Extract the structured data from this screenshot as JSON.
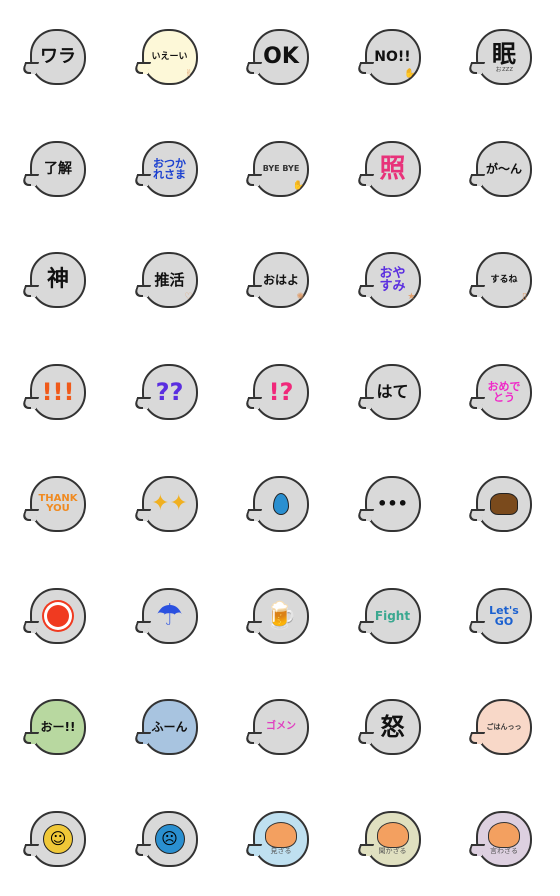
{
  "colors": {
    "bubble_gray": "#d9d9d9",
    "outline": "#333333"
  },
  "stickers": [
    {
      "name": "wara",
      "text": "ワラ",
      "color": "#111",
      "size": 18,
      "bg": "#d9d9d9"
    },
    {
      "name": "ieei",
      "text": "いえーい",
      "color": "#111",
      "size": 9,
      "bg": "#fdf8d8",
      "icon": "peace-hand"
    },
    {
      "name": "ok",
      "text": "OK",
      "color": "#111",
      "size": 22,
      "bg": "#d9d9d9",
      "icon": "sparkle"
    },
    {
      "name": "no",
      "text": "NO!!",
      "color": "#111",
      "size": 14,
      "bg": "#d9d9d9",
      "icon": "raised-hand"
    },
    {
      "name": "nemui",
      "text": "眠",
      "sub": "ぉzzz",
      "color": "#111",
      "size": 24,
      "bg": "#d9d9d9"
    },
    {
      "name": "ryoukai",
      "text": "了解",
      "color": "#111",
      "size": 14,
      "bg": "#d9d9d9",
      "icon": "ear"
    },
    {
      "name": "otsukaresama",
      "text": "おつか\nれさま",
      "color": "#1a3fd0",
      "size": 11,
      "bg": "#d9d9d9"
    },
    {
      "name": "byebye",
      "text": "BYE BYE",
      "color": "#333",
      "size": 8,
      "bg": "#d9d9d9",
      "icon": "waving-hand"
    },
    {
      "name": "tere",
      "text": "照",
      "color": "#e8327a",
      "size": 26,
      "bg": "#d9d9d9"
    },
    {
      "name": "gaan",
      "text": "が〜ん",
      "color": "#111",
      "size": 12,
      "bg": "#d9d9d9"
    },
    {
      "name": "kami",
      "text": "神",
      "color": "#111",
      "size": 22,
      "bg": "#d9d9d9",
      "icon": "halo"
    },
    {
      "name": "oshikatsu",
      "text": "推活",
      "color": "#111",
      "size": 15,
      "bg": "#d9d9d9",
      "icon": "hearts"
    },
    {
      "name": "ohayo",
      "text": "おはよ",
      "color": "#111",
      "size": 12,
      "bg": "#d9d9d9",
      "icon": "sun-doodle"
    },
    {
      "name": "oyasumi",
      "text": "おや\nすみ",
      "color": "#5a2ee0",
      "size": 13,
      "bg": "#d9d9d9",
      "icon": "stars"
    },
    {
      "name": "surune",
      "text": "するね",
      "color": "#111",
      "size": 9,
      "bg": "#d9d9d9",
      "icon": "phone"
    },
    {
      "name": "exclaim",
      "text": "!!!",
      "color": "#f05a1a",
      "size": 24,
      "bg": "#d9d9d9"
    },
    {
      "name": "question",
      "text": "??",
      "color": "#5a2ee0",
      "size": 24,
      "bg": "#d9d9d9"
    },
    {
      "name": "exclaim-question",
      "text": "!?",
      "color": "#f0287a",
      "size": 24,
      "bg": "#d9d9d9"
    },
    {
      "name": "hate",
      "text": "はて",
      "color": "#111",
      "size": 16,
      "bg": "#d9d9d9"
    },
    {
      "name": "omedetou",
      "text": "おめで\nとう",
      "color": "#f028c8",
      "size": 11,
      "bg": "#d9d9d9",
      "icon": "party-popper"
    },
    {
      "name": "thankyou",
      "text": "THANK\nYOU",
      "color": "#f08a20",
      "size": 10,
      "bg": "#d9d9d9"
    },
    {
      "name": "sparkles",
      "text": "",
      "color": "#f0b020",
      "size": 22,
      "bg": "#d9d9d9",
      "icon": "sparkles"
    },
    {
      "name": "sweat",
      "text": "",
      "color": "#2a8fd0",
      "size": 20,
      "bg": "#d9d9d9",
      "icon": "droplet"
    },
    {
      "name": "ellipsis",
      "text": "•••",
      "color": "#111",
      "size": 16,
      "bg": "#d9d9d9"
    },
    {
      "name": "poop",
      "text": "",
      "color": "#7a4a1c",
      "size": 20,
      "bg": "#d9d9d9",
      "icon": "poop"
    },
    {
      "name": "sun",
      "text": "",
      "color": "#f03a20",
      "size": 20,
      "bg": "#d9d9d9",
      "icon": "sun"
    },
    {
      "name": "umbrella",
      "text": "",
      "color": "#2a50e0",
      "size": 30,
      "bg": "#d9d9d9",
      "icon": "umbrella"
    },
    {
      "name": "beer",
      "text": "",
      "color": "#f0b020",
      "size": 26,
      "bg": "#d9d9d9",
      "icon": "beer"
    },
    {
      "name": "fight",
      "text": "Fight",
      "color": "#3aa890",
      "size": 12,
      "bg": "#d9d9d9",
      "icon": "flexed-arm"
    },
    {
      "name": "letsgo",
      "text": "Let's\nGO",
      "color": "#1a60d0",
      "size": 11,
      "bg": "#d9d9d9"
    },
    {
      "name": "oo",
      "text": "おー!!",
      "color": "#111",
      "size": 12,
      "bg": "#b8d8a0"
    },
    {
      "name": "fuun",
      "text": "ふーん",
      "color": "#111",
      "size": 12,
      "bg": "#a8c4e0"
    },
    {
      "name": "gomen",
      "text": "ゴメン",
      "color": "#e040c0",
      "size": 10,
      "bg": "#d9d9d9",
      "icon": "pressed-hands"
    },
    {
      "name": "ikari",
      "text": "怒",
      "color": "#111",
      "size": 24,
      "bg": "#d9d9d9"
    },
    {
      "name": "gohan",
      "text": "ごはんっっ",
      "color": "#333",
      "size": 7,
      "bg": "#f8d8c8",
      "icon": "fork-knife-egg"
    },
    {
      "name": "smile",
      "text": "",
      "color": "#f0c838",
      "size": 16,
      "bg": "#d9d9d9",
      "icon": "smiley-face"
    },
    {
      "name": "sad",
      "text": "",
      "color": "#2a8fd0",
      "size": 16,
      "bg": "#d9d9d9",
      "icon": "sad-face"
    },
    {
      "name": "mizaru",
      "text": "",
      "sub": "見ざる",
      "color": "#333",
      "size": 7,
      "bg": "#bfe0f0",
      "icon": "monkey"
    },
    {
      "name": "kikazaru",
      "text": "",
      "sub": "聞かざる",
      "color": "#333",
      "size": 7,
      "bg": "#e0e0c0",
      "icon": "monkey"
    },
    {
      "name": "iwazaru",
      "text": "",
      "sub": "言わざる",
      "color": "#333",
      "size": 7,
      "bg": "#ddd0e0",
      "icon": "monkey"
    }
  ]
}
